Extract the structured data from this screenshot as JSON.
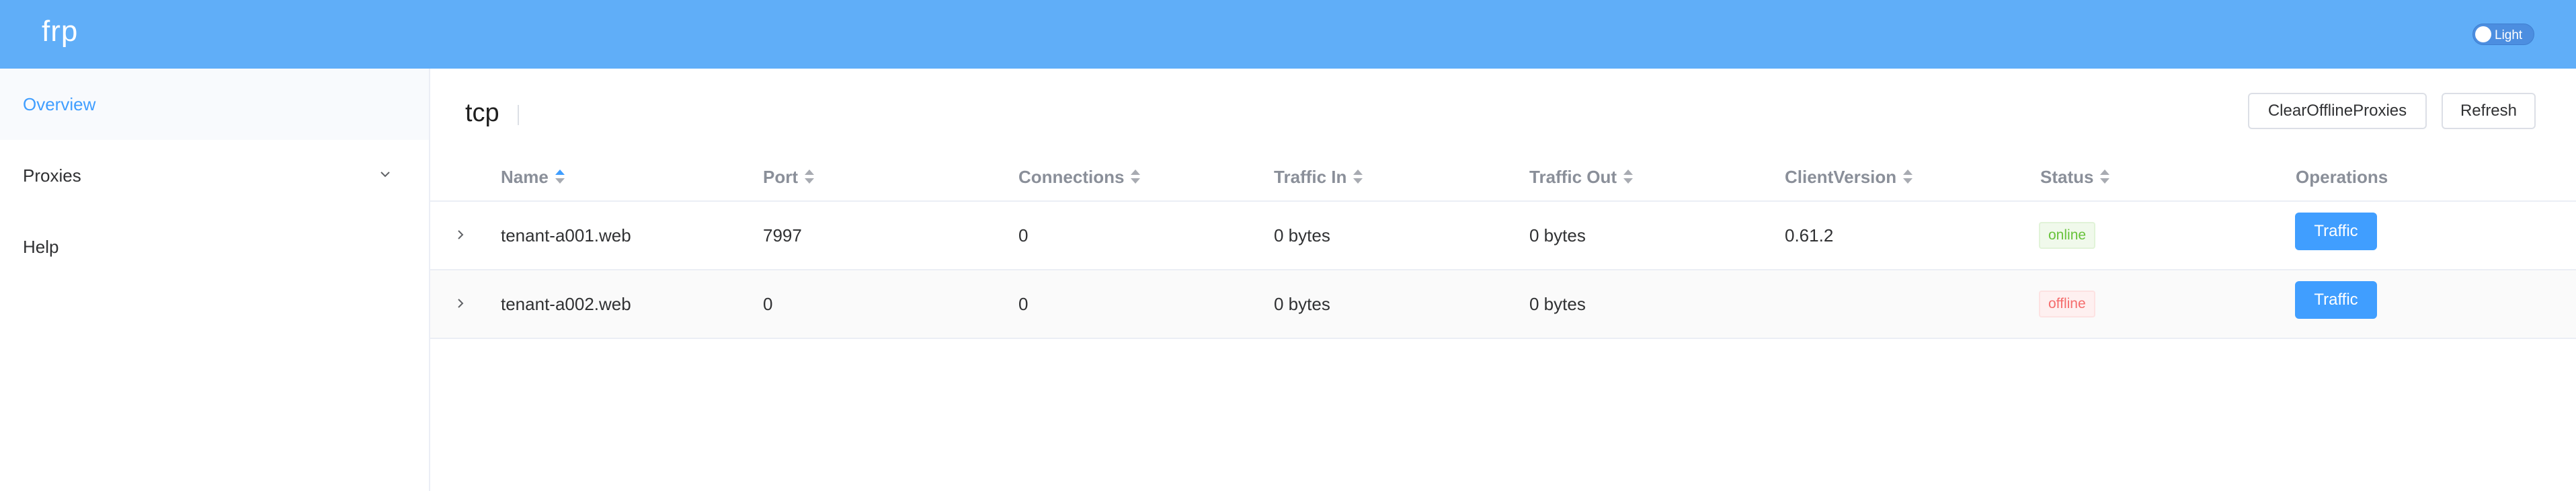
{
  "header": {
    "brand": "frp",
    "theme_toggle_label": "Light"
  },
  "sidebar": {
    "items": [
      {
        "label": "Overview",
        "active": true
      },
      {
        "label": "Proxies",
        "icon": "chevron-down-icon"
      },
      {
        "label": "Help"
      }
    ]
  },
  "main": {
    "title": "tcp",
    "buttons": {
      "clear_offline": "ClearOfflineProxies",
      "refresh": "Refresh"
    },
    "table": {
      "columns": [
        "Name",
        "Port",
        "Connections",
        "Traffic In",
        "Traffic Out",
        "ClientVersion",
        "Status",
        "Operations"
      ],
      "sorted_column": "Name",
      "sort_direction": "ascending",
      "rows": [
        {
          "name": "tenant-a001.web",
          "port": "7997",
          "connections": "0",
          "traffic_in": "0 bytes",
          "traffic_out": "0 bytes",
          "client_version": "0.61.2",
          "status": "online",
          "action": "Traffic"
        },
        {
          "name": "tenant-a002.web",
          "port": "0",
          "connections": "0",
          "traffic_in": "0 bytes",
          "traffic_out": "0 bytes",
          "client_version": "",
          "status": "offline",
          "action": "Traffic"
        }
      ]
    }
  },
  "colors": {
    "header_bg": "#60aef8",
    "accent": "#409eff",
    "online": "#67c23a",
    "offline": "#f56c6c"
  }
}
